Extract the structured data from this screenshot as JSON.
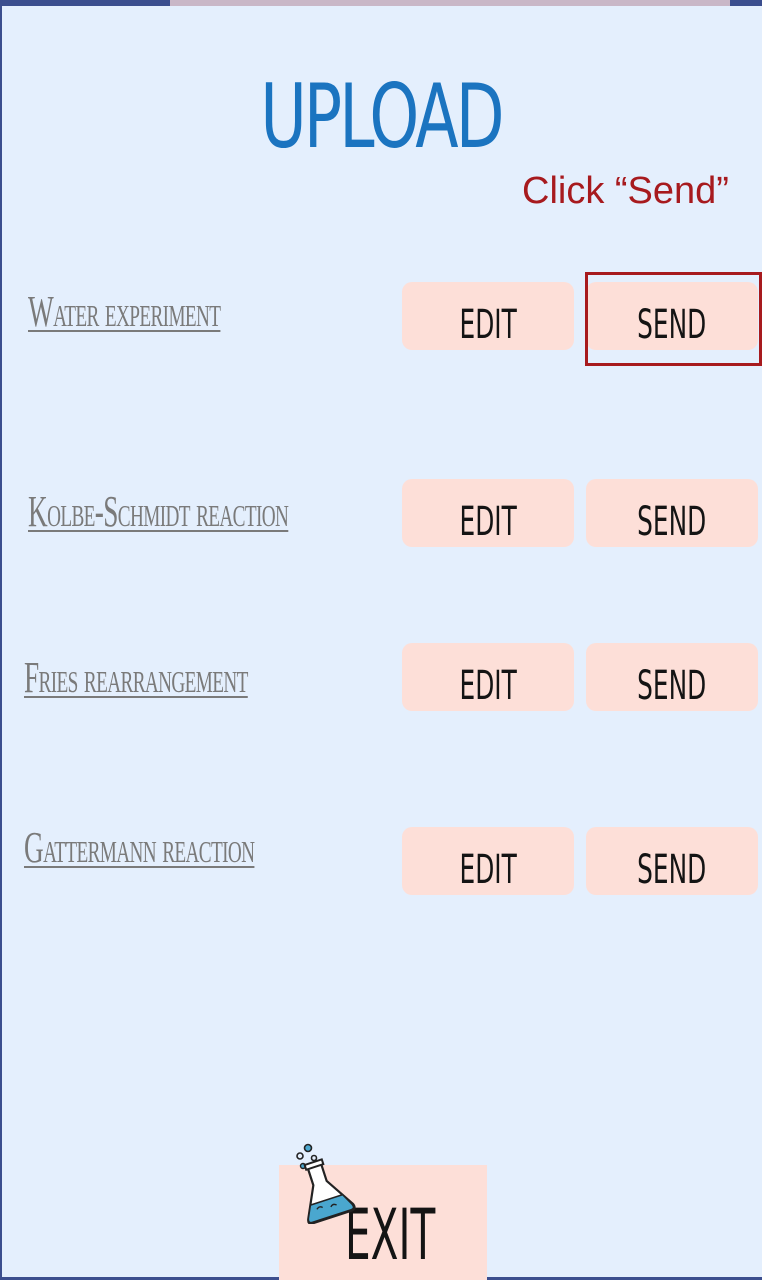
{
  "page": {
    "title": "UPLOAD",
    "hint": "Click “Send”",
    "exit_label": "EXIT",
    "colors": {
      "background": "#e4effd",
      "title": "#1b74c0",
      "hint": "#a71a1e",
      "button_bg": "#fddfd8",
      "label_text": "#7a7a7a"
    }
  },
  "experiments": [
    {
      "name": "Water experiment",
      "edit_label": "EDIT",
      "send_label": "SEND",
      "highlighted": true
    },
    {
      "name": "Kolbe-Schmidt reaction",
      "edit_label": "EDIT",
      "send_label": "SEND"
    },
    {
      "name": "Fries rearrangement",
      "edit_label": "EDIT",
      "send_label": "SEND"
    },
    {
      "name": "Gattermann reaction",
      "edit_label": "EDIT",
      "send_label": "SEND"
    }
  ],
  "icons": {
    "exit_icon": "flask-icon"
  }
}
